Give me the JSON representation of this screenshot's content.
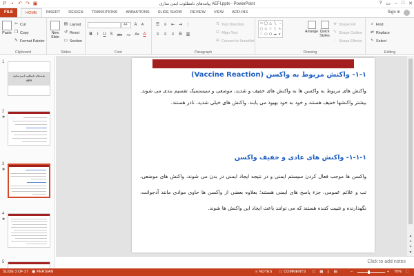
{
  "window": {
    "title": "پیامدهای نامطلوب ایمن سازی AEFI.pptx - PowerPoint",
    "controls": [
      "?",
      "▭",
      "–",
      "□",
      "✕"
    ]
  },
  "tabs": {
    "file": "FILE",
    "items": [
      "HOME",
      "INSERT",
      "DESIGN",
      "TRANSITIONS",
      "ANIMATIONS",
      "SLIDE SHOW",
      "REVIEW",
      "VIEW",
      "ADD-INS"
    ],
    "active": "HOME",
    "sign_in": "Sign in"
  },
  "ribbon": {
    "clipboard": {
      "label": "Clipboard",
      "paste": "Paste",
      "cut": "Cut",
      "copy": "Copy",
      "format_painter": "Format Painter"
    },
    "slides": {
      "label": "Slides",
      "new_slide": "New Slide",
      "layout": "Layout",
      "reset": "Reset",
      "section": "Section"
    },
    "font": {
      "label": "Font",
      "font_size": "44",
      "buttons": [
        "A",
        "A",
        "B",
        "I",
        "U",
        "S",
        "abc",
        "AV",
        "Aa",
        "A"
      ]
    },
    "paragraph": {
      "label": "Paragraph",
      "text_direction": "Text Direction",
      "align_text": "Align Text",
      "convert_smartart": "Convert to SmartArt"
    },
    "drawing": {
      "label": "Drawing",
      "arrange": "Arrange",
      "quick_styles": "Quick Styles",
      "shape_fill": "Shape Fill",
      "shape_outline": "Shape Outline",
      "shape_effects": "Shape Effects"
    },
    "editing": {
      "label": "Editing",
      "find": "Find",
      "replace": "Replace",
      "select": "Select"
    }
  },
  "thumbnails": {
    "numbers": [
      "1",
      "2",
      "3",
      "4",
      "5"
    ],
    "slide1_title": "پیامدهای نامطلوب ایمن سازی",
    "slide1_subtitle": "AEFI"
  },
  "slide": {
    "heading1": "۱-۱- واکنش مربوط به واکسن (Vaccine Reaction)",
    "para1": "واکنش های مربوط به واکسن ها به واکنش های خفیف و شدید، موضعی و سیستمیک تقسیم بندی می شوند. بیشتر واکنشها خفیف هستند و خود به خود بهبود می یابند. واکنش های خیلی شدید، نادر هستند.",
    "heading2": "۱-۱-۱- واکنش های عادی و خفیف واکسن",
    "para2": "واکسن ها موجب فعال کردن سیستم ایمنی و در نتیجه ایجاد ایمنی در بدن می شوند، واکنش های موضعی، تب و علائم عمومی، جزء پاسخ های ایمنی هستند؛ بعلاوه بعضی از واکسن ها حاوی موادی مانند آدجوانت، نگهدارنده و تثبیت کننده هستند که می توانند باعث ایجاد این واکنش ها شوند."
  },
  "notes_placeholder": "Click to add notes",
  "status": {
    "slide_indicator": "SLIDE 3 OF 37",
    "language": "PERSIAN",
    "notes": "NOTES",
    "comments": "COMMENTS",
    "zoom": "70%"
  },
  "colors": {
    "accent": "#c43e1c",
    "slide_bar": "#a31f1f",
    "heading": "#1f5fc1"
  }
}
